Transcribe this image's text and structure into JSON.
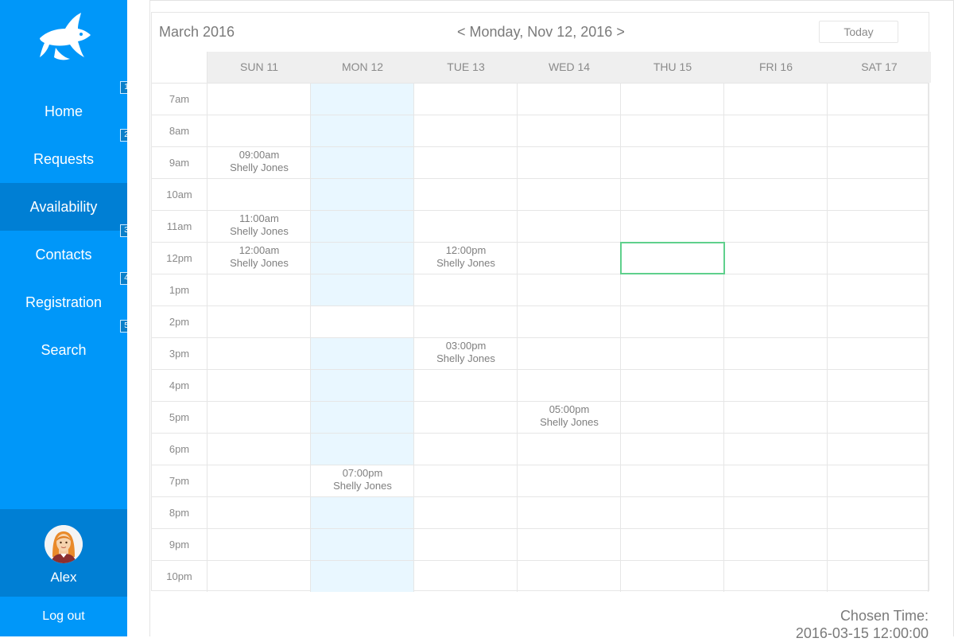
{
  "sidebar": {
    "nav": [
      {
        "label": "Home",
        "badge": "1",
        "active": false
      },
      {
        "label": "Requests",
        "badge": "2",
        "active": false
      },
      {
        "label": "Availability",
        "badge": "",
        "active": true
      },
      {
        "label": "Contacts",
        "badge": "3",
        "active": false
      },
      {
        "label": "Registration",
        "badge": "4",
        "active": false
      },
      {
        "label": "Search",
        "badge": "5",
        "active": false
      }
    ],
    "user_name": "Alex",
    "logout_label": "Log out"
  },
  "calendar": {
    "month_title": "March 2016",
    "prev_symbol": "<",
    "current_date": "Monday, Nov 12, 2016",
    "next_symbol": ">",
    "today_label": "Today",
    "days": [
      "SUN 11",
      "MON 12",
      "TUE 13",
      "WED 14",
      "THU 15",
      "FRI 16",
      "SAT 17"
    ],
    "today_index": 1,
    "today_no_highlight_rows": [
      7,
      12
    ],
    "times": [
      "7am",
      "8am",
      "9am",
      "10am",
      "11am",
      "12pm",
      "1pm",
      "2pm",
      "3pm",
      "4pm",
      "5pm",
      "6pm",
      "7pm",
      "8pm",
      "9pm",
      "10pm"
    ],
    "events": [
      {
        "day": 0,
        "row": 2,
        "time": "09:00am",
        "name": "Shelly Jones"
      },
      {
        "day": 0,
        "row": 4,
        "time": "11:00am",
        "name": "Shelly Jones"
      },
      {
        "day": 0,
        "row": 5,
        "time": "12:00am",
        "name": "Shelly Jones"
      },
      {
        "day": 2,
        "row": 5,
        "time": "12:00pm",
        "name": "Shelly Jones"
      },
      {
        "day": 2,
        "row": 8,
        "time": "03:00pm",
        "name": "Shelly Jones"
      },
      {
        "day": 3,
        "row": 10,
        "time": "05:00pm",
        "name": "Shelly Jones"
      },
      {
        "day": 1,
        "row": 12,
        "time": "07:00pm",
        "name": "Shelly Jones"
      }
    ],
    "selected": {
      "day": 4,
      "row": 5
    }
  },
  "chosen": {
    "label": "Chosen Time:",
    "value": "2016-03-15 12:00:00"
  },
  "colors": {
    "sidebar": "#0097f9",
    "sidebar_active": "#007fd4",
    "today_column": "#e9f7ff",
    "selection": "#5fd08c"
  }
}
